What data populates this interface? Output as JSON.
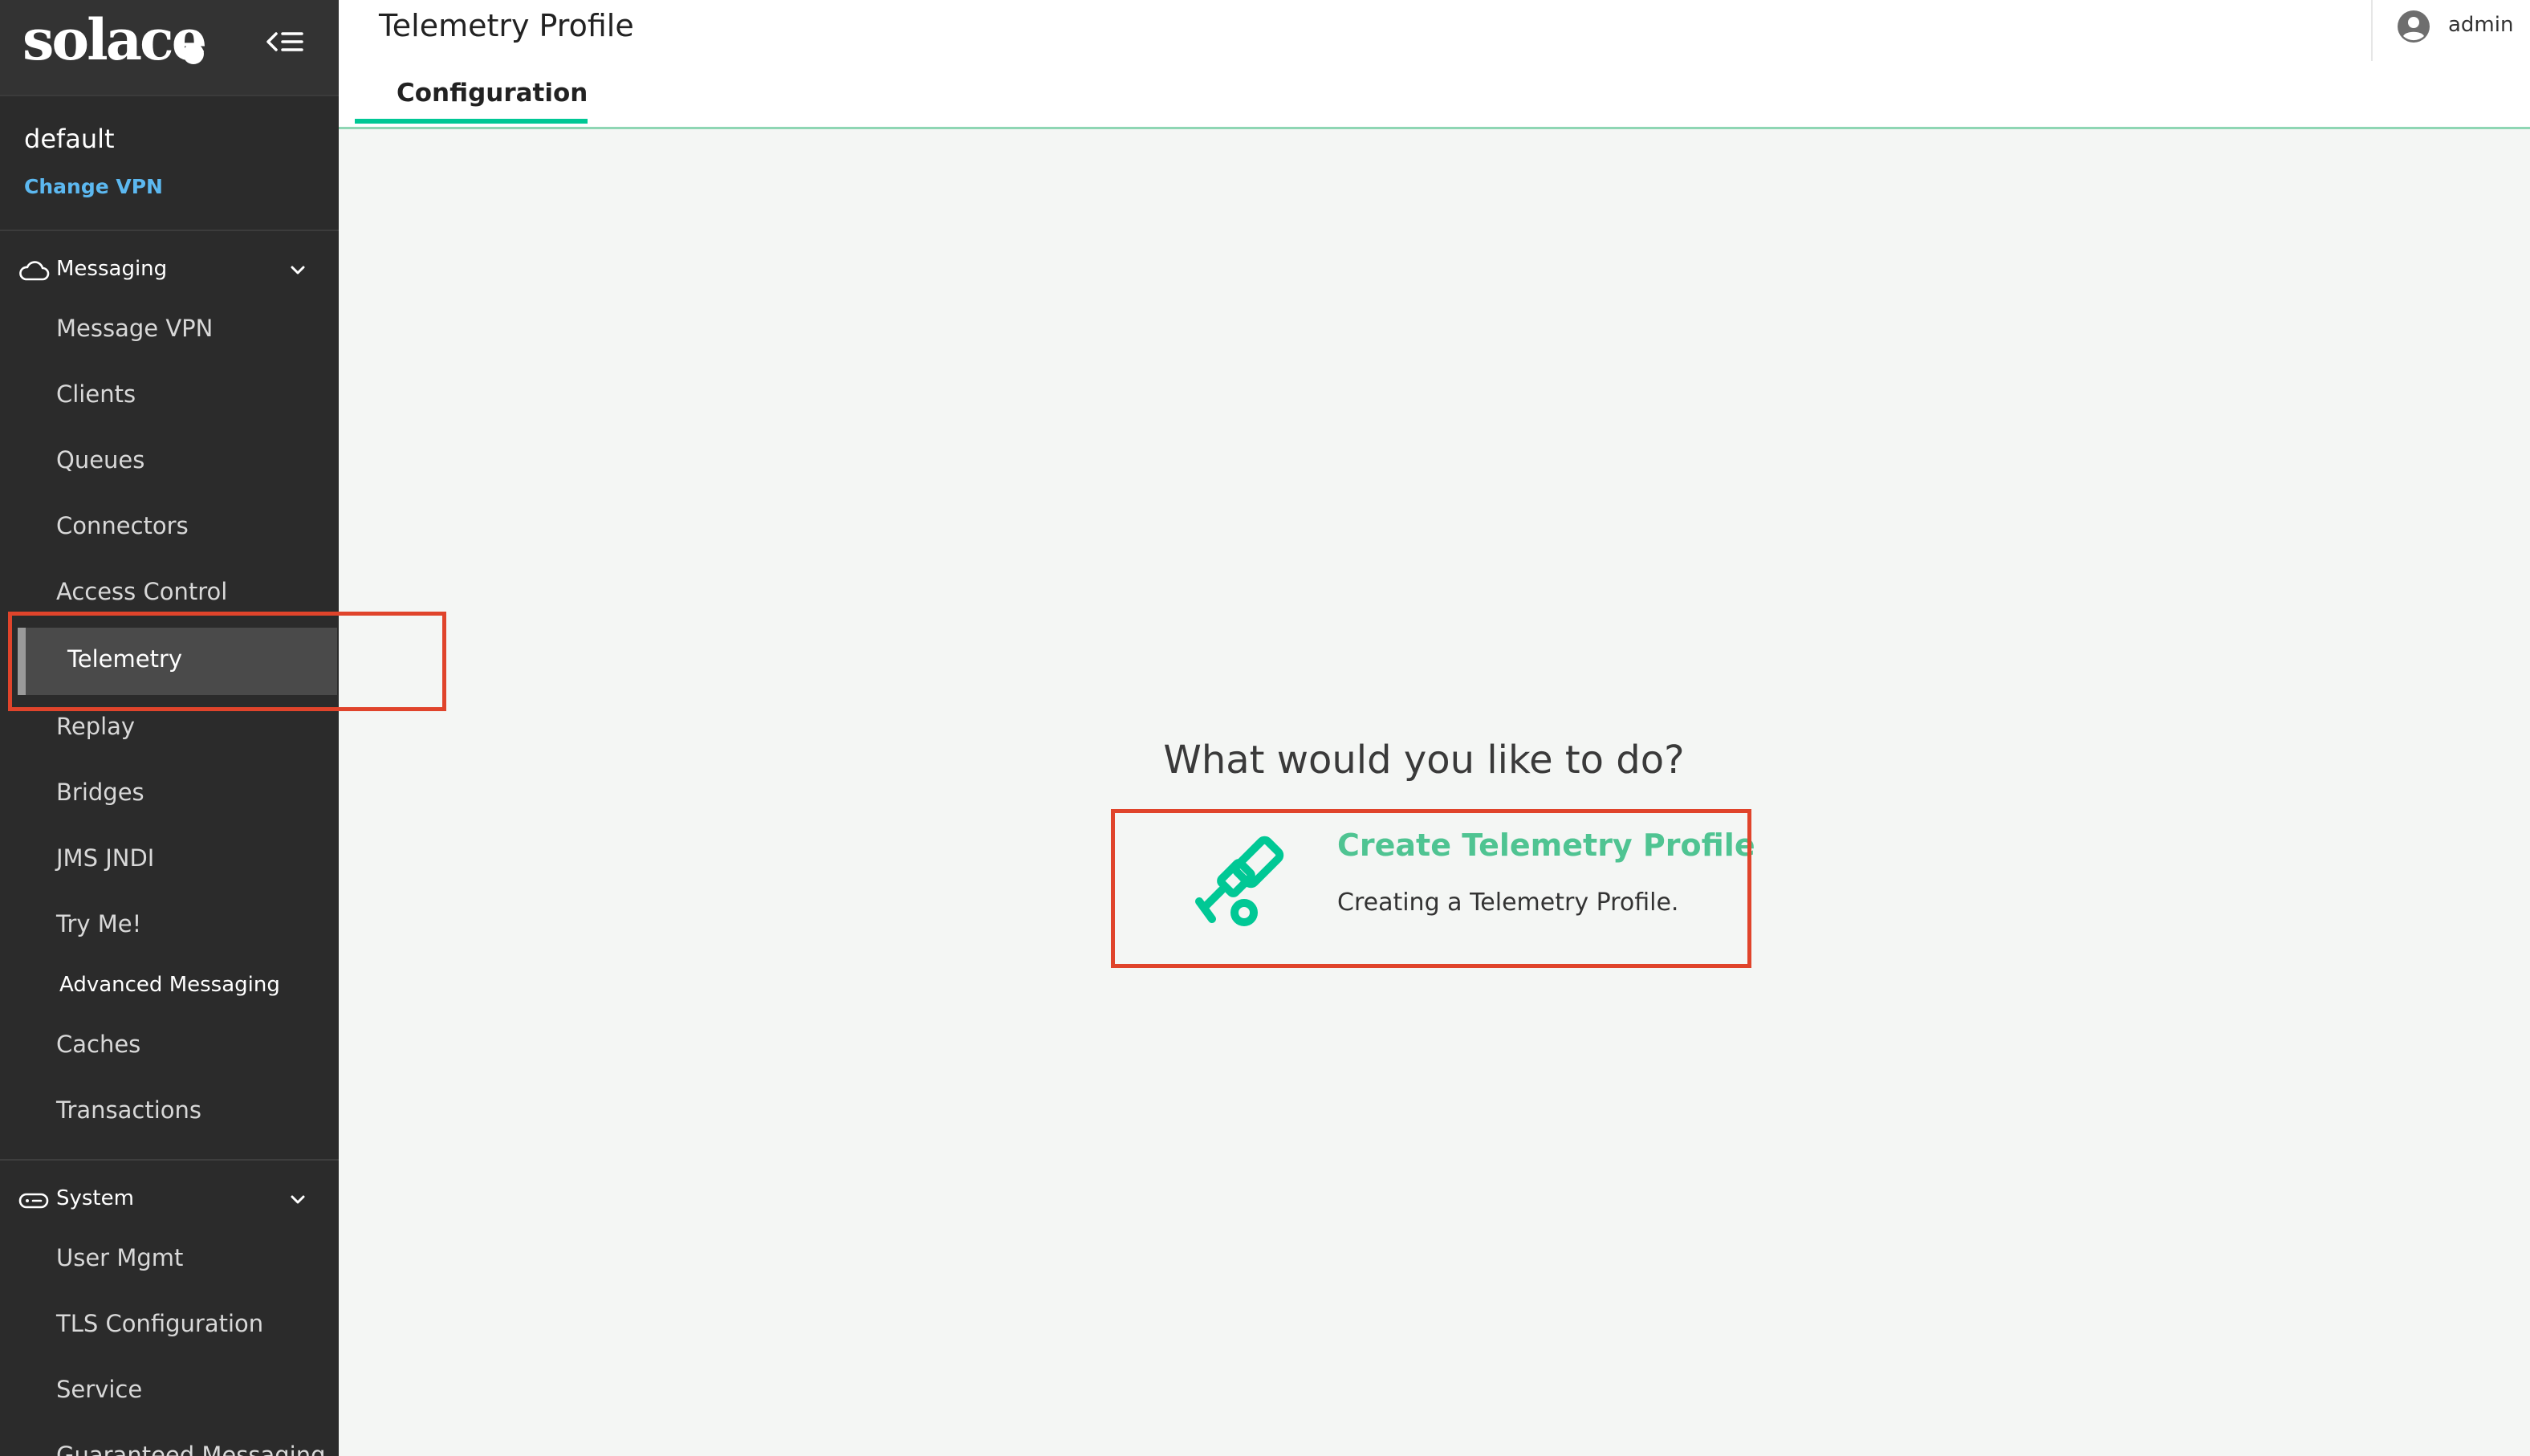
{
  "brand": {
    "logo_text": "solace"
  },
  "vpn": {
    "name": "default",
    "change_label": "Change VPN"
  },
  "sidebar": {
    "messaging": {
      "label": "Messaging",
      "icon": "cloud-icon",
      "items": [
        {
          "label": "Message VPN"
        },
        {
          "label": "Clients"
        },
        {
          "label": "Queues"
        },
        {
          "label": "Connectors"
        },
        {
          "label": "Access Control"
        },
        {
          "label": "Telemetry",
          "active": true
        },
        {
          "label": "Replay"
        },
        {
          "label": "Bridges"
        },
        {
          "label": "JMS JNDI"
        },
        {
          "label": "Try Me!"
        }
      ],
      "advanced_header": "Advanced Messaging",
      "advanced_items": [
        {
          "label": "Caches"
        },
        {
          "label": "Transactions"
        }
      ]
    },
    "system": {
      "label": "System",
      "icon": "server-icon",
      "items": [
        {
          "label": "User Mgmt"
        },
        {
          "label": "TLS Configuration"
        },
        {
          "label": "Service"
        },
        {
          "label": "Guaranteed Messaging"
        }
      ]
    }
  },
  "header": {
    "title": "Telemetry Profile",
    "tabs": [
      {
        "label": "Configuration",
        "active": true
      }
    ],
    "user": "admin"
  },
  "main": {
    "prompt": "What would you like to do?",
    "action": {
      "title": "Create Telemetry Profile",
      "description": "Creating a Telemetry Profile.",
      "icon": "telescope-icon"
    }
  },
  "colors": {
    "accent": "#00c895",
    "link": "#5cb8f0",
    "highlight": "#e0442b",
    "sidebar_bg": "#2b2b2b"
  }
}
